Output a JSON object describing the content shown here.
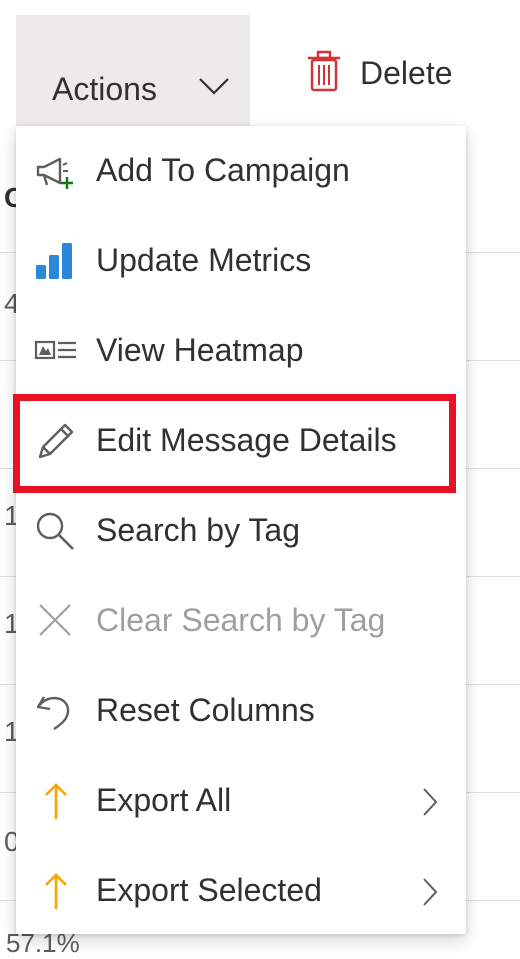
{
  "toolbar": {
    "actions_label": "Actions",
    "delete_label": "Delete"
  },
  "background": {
    "header_fragment": "C",
    "row_fragments": [
      "4",
      "",
      "1",
      "1",
      "1",
      "0"
    ],
    "bottom_fragment": "57.1%"
  },
  "menu": {
    "items": [
      {
        "label": "Add To Campaign",
        "icon": "megaphone-add-icon",
        "disabled": false,
        "submenu": false
      },
      {
        "label": "Update Metrics",
        "icon": "bar-chart-icon",
        "disabled": false,
        "submenu": false
      },
      {
        "label": "View Heatmap",
        "icon": "heatmap-icon",
        "disabled": false,
        "submenu": false
      },
      {
        "label": "Edit Message Details",
        "icon": "pencil-icon",
        "disabled": false,
        "submenu": false,
        "highlighted": true
      },
      {
        "label": "Search by Tag",
        "icon": "search-icon",
        "disabled": false,
        "submenu": false
      },
      {
        "label": "Clear Search by Tag",
        "icon": "close-icon",
        "disabled": true,
        "submenu": false
      },
      {
        "label": "Reset Columns",
        "icon": "undo-icon",
        "disabled": false,
        "submenu": false
      },
      {
        "label": "Export All",
        "icon": "arrow-up-icon",
        "disabled": false,
        "submenu": true
      },
      {
        "label": "Export Selected",
        "icon": "arrow-up-icon",
        "disabled": false,
        "submenu": true
      }
    ]
  },
  "colors": {
    "chart_blue": "#2b88d8",
    "export_orange": "#f7a600",
    "delete_red": "#d13438",
    "highlight_red": "#e81123",
    "add_green": "#107c10"
  }
}
